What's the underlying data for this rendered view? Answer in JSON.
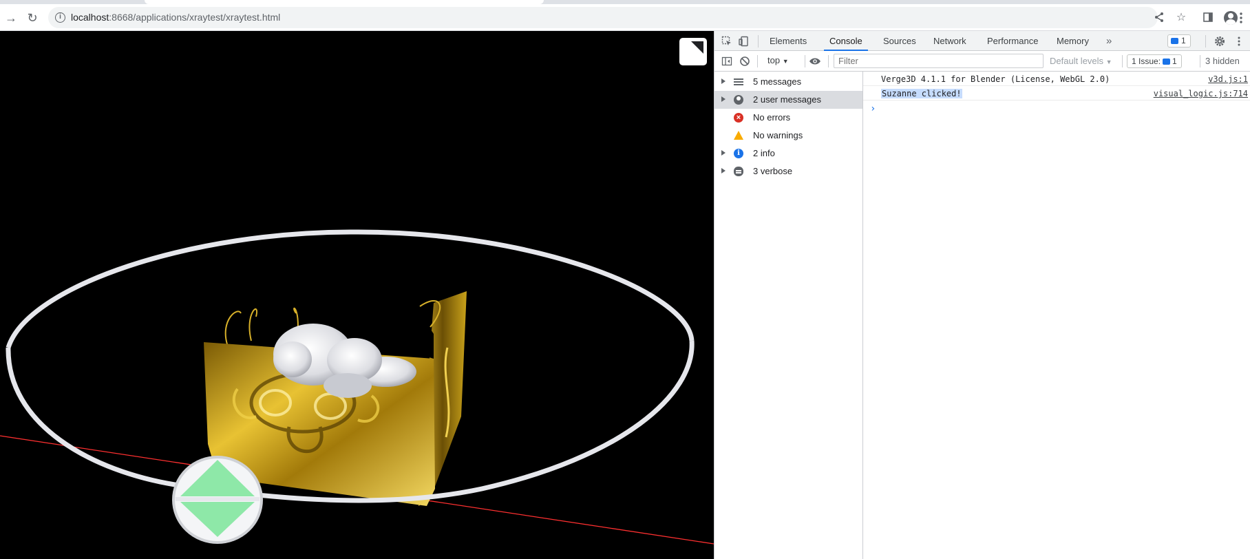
{
  "browser": {
    "url_host": "localhost",
    "url_path": ":8668/applications/xraytest/xraytest.html"
  },
  "devtools": {
    "tabs": [
      {
        "label": "Elements"
      },
      {
        "label": "Console"
      },
      {
        "label": "Sources"
      },
      {
        "label": "Network"
      },
      {
        "label": "Performance"
      },
      {
        "label": "Memory"
      }
    ],
    "more_tabs": "»",
    "messages_badge": "1",
    "context": "top",
    "filter_placeholder": "Filter",
    "levels": "Default levels",
    "issues": {
      "label": "1 Issue:",
      "count": "1"
    },
    "hidden": "3 hidden",
    "sidebar": [
      {
        "label": "5 messages",
        "icon": "list-icon"
      },
      {
        "label": "2 user messages",
        "icon": "user-icon"
      },
      {
        "label": "No errors",
        "icon": "error-icon"
      },
      {
        "label": "No warnings",
        "icon": "warning-icon"
      },
      {
        "label": "2 info",
        "icon": "info-icon"
      },
      {
        "label": "3 verbose",
        "icon": "bug-icon"
      }
    ],
    "console": [
      {
        "message": "Verge3D 4.1.1 for Blender (License, WebGL 2.0)",
        "source": "v3d.js:1"
      },
      {
        "message": "Suzanne clicked!",
        "source": "visual_logic.js:714"
      }
    ],
    "prompt": "›"
  },
  "colors": {
    "gold": "#c9a21a",
    "ring": "#e6e7ec",
    "gizmo_green": "#8ee8a8",
    "axis_red": "#ff3030",
    "devtools_accent": "#1a73e8"
  }
}
